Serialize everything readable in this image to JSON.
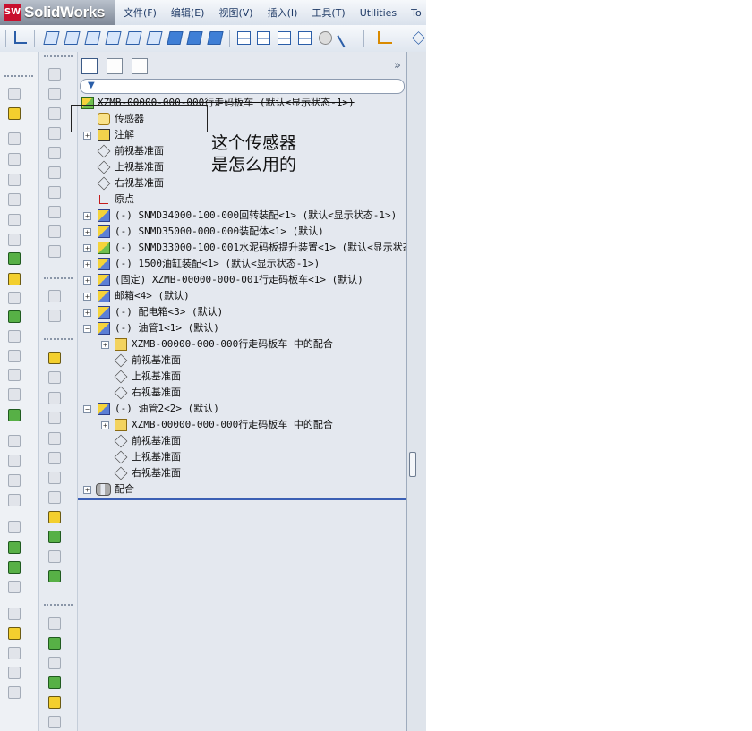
{
  "app": {
    "brand": "SolidWorks",
    "logo_text": "SW"
  },
  "menu": [
    "文件(F)",
    "编辑(E)",
    "视图(V)",
    "插入(I)",
    "工具(T)",
    "Utilities",
    "To"
  ],
  "panel": {
    "expand_label": "»",
    "filter_icon": "▼"
  },
  "tree": [
    {
      "label": "XZMB-00000-000-000行走码板车  (默认<显示状态-1>)",
      "icon": "assembly-icon",
      "expander": ""
    },
    {
      "label": "传感器",
      "icon": "sensor-icon",
      "expander": ""
    },
    {
      "label": "注解",
      "icon": "annotation-icon",
      "expander": "+"
    },
    {
      "label": "前视基准面",
      "icon": "plane-icon",
      "expander": ""
    },
    {
      "label": "上视基准面",
      "icon": "plane-icon",
      "expander": ""
    },
    {
      "label": "右视基准面",
      "icon": "plane-icon",
      "expander": ""
    },
    {
      "label": "原点",
      "icon": "origin-icon",
      "expander": ""
    },
    {
      "label": "(-) SNMD34000-100-000回转装配<1> (默认<显示状态-1>)",
      "icon": "subassembly-icon",
      "expander": "+"
    },
    {
      "label": "(-) SNMD35000-000-000装配体<1> (默认)",
      "icon": "subassembly-icon",
      "expander": "+"
    },
    {
      "label": "(-) SNMD33000-100-001水泥码板提升装置<1> (默认<显示状态",
      "icon": "assembly-icon",
      "expander": "+"
    },
    {
      "label": "(-) 1500油缸装配<1> (默认<显示状态-1>)",
      "icon": "subassembly-icon",
      "expander": "+"
    },
    {
      "label": "(固定) XZMB-00000-000-001行走码板车<1> (默认)",
      "icon": "subassembly-icon",
      "expander": "+"
    },
    {
      "label": "邮箱<4> (默认)",
      "icon": "subassembly-icon",
      "expander": "+"
    },
    {
      "label": "(-) 配电箱<3> (默认)",
      "icon": "subassembly-icon",
      "expander": "+"
    },
    {
      "label": "(-) 油管1<1> (默认)",
      "icon": "subassembly-icon",
      "expander": "−"
    },
    {
      "label": "XZMB-00000-000-000行走码板车 中的配合",
      "icon": "mate-icon",
      "expander": "+"
    },
    {
      "label": "前视基准面",
      "icon": "plane-icon",
      "expander": ""
    },
    {
      "label": "上视基准面",
      "icon": "plane-icon",
      "expander": ""
    },
    {
      "label": "右视基准面",
      "icon": "plane-icon",
      "expander": ""
    },
    {
      "label": "(-) 油管2<2> (默认)",
      "icon": "subassembly-icon",
      "expander": "−"
    },
    {
      "label": "XZMB-00000-000-000行走码板车 中的配合",
      "icon": "mate-icon",
      "expander": "+"
    },
    {
      "label": "前视基准面",
      "icon": "plane-icon",
      "expander": ""
    },
    {
      "label": "上视基准面",
      "icon": "plane-icon",
      "expander": ""
    },
    {
      "label": "右视基准面",
      "icon": "plane-icon",
      "expander": ""
    },
    {
      "label": "配合",
      "icon": "mates-folder-icon",
      "expander": "+"
    }
  ],
  "annotation_text": "这个传感器\n是怎么用的"
}
